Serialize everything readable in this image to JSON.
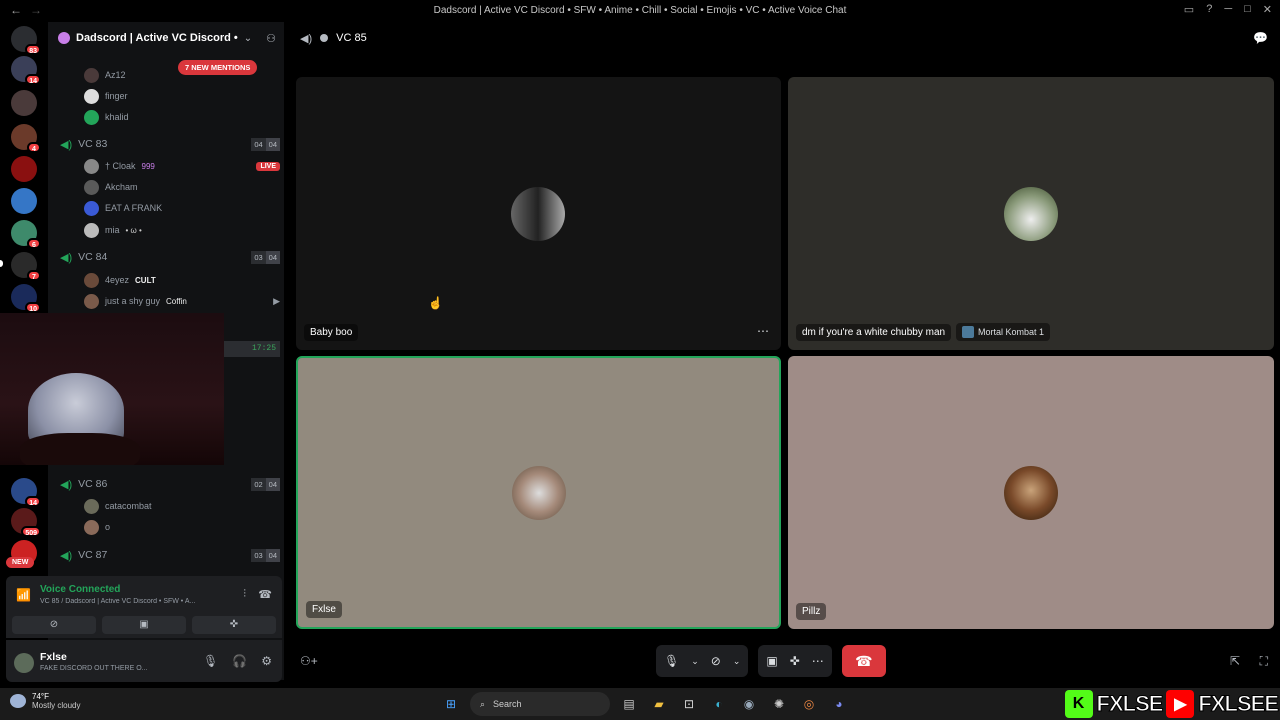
{
  "window": {
    "title": "Dadscord | Active VC Discord • SFW • Anime • Chill • Social • Emojis • VC • Active Voice Chat"
  },
  "server_bar": {
    "items": [
      {
        "badge": "83"
      },
      {
        "badge": "14"
      },
      {
        "badge": ""
      },
      {
        "badge": "4"
      },
      {
        "badge": ""
      },
      {
        "badge": ""
      },
      {
        "badge": "6"
      },
      {
        "badge": "7"
      },
      {
        "badge": "10"
      },
      {
        "badge": ""
      },
      {
        "badge": "14"
      },
      {
        "badge": "509"
      }
    ],
    "new_label": "NEW"
  },
  "sidebar": {
    "server_name": "Dadscord | Active VC Discord • SF...",
    "new_mentions": "7 NEW MENTIONS",
    "channel_time": "17:25",
    "channels": [
      {
        "name": "VC 83",
        "count_a": "04",
        "count_b": "04"
      },
      {
        "name": "VC 84",
        "count_a": "03",
        "count_b": "04"
      },
      {
        "name": "VC 86",
        "count_a": "02",
        "count_b": "04"
      },
      {
        "name": "VC 87",
        "count_a": "03",
        "count_b": "04"
      }
    ],
    "users": [
      {
        "name": "Az12"
      },
      {
        "name": "finger"
      },
      {
        "name": "khalid"
      },
      {
        "name": "† Cloak",
        "tag": "999",
        "live": "LIVE"
      },
      {
        "name": "Akcham"
      },
      {
        "name": "EAT A FRANK"
      },
      {
        "name": "mia",
        "tag": "• ω •"
      },
      {
        "name": "4eyez",
        "tag": "CULT"
      },
      {
        "name": "just a shy guy",
        "tag": "Coffin"
      },
      {
        "name": "catacombat"
      },
      {
        "name": "o"
      }
    ]
  },
  "voice_panel": {
    "status": "Voice Connected",
    "subtitle": "VC 85 / Dadscord | Active VC Discord • SFW • A..."
  },
  "user_panel": {
    "name": "Fxlse",
    "status": "FAKE DISCORD OUT THERE O..."
  },
  "main": {
    "channel_name": "VC 85",
    "tiles": [
      {
        "name": "Baby boo",
        "bg": "#141414"
      },
      {
        "name": "dm if you're a white chubby man",
        "bg": "#2e2d29",
        "activity": "Mortal Kombat 1"
      },
      {
        "name": "Fxlse",
        "bg": "#928a7e",
        "speaking": true
      },
      {
        "name": "Pillz",
        "bg": "#9f8c87"
      }
    ]
  },
  "taskbar": {
    "temperature": "74°F",
    "condition": "Mostly cloudy",
    "search_placeholder": "Search"
  },
  "overlay": {
    "kick_name": "FXLSE",
    "youtube_name": "FXLSEE"
  },
  "colors": {
    "accent_green": "#23a55a",
    "danger_red": "#da373c",
    "sidebar_bg": "#111214"
  }
}
